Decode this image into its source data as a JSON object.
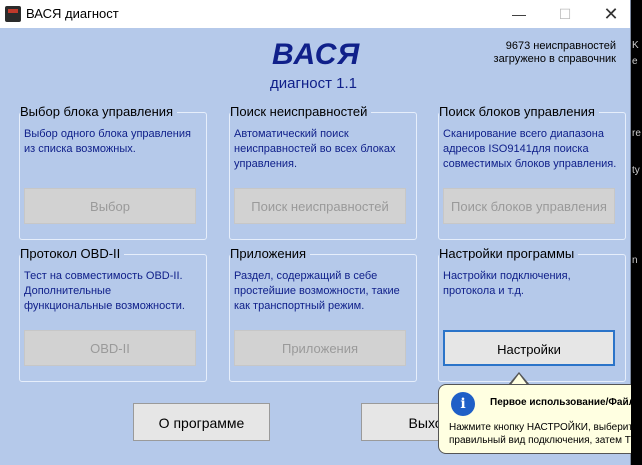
{
  "window": {
    "title": "ВАСЯ диагност",
    "minimize_glyph": "—",
    "maximize_glyph": "☐",
    "close_glyph": "✕"
  },
  "header": {
    "logo": "ВАСЯ",
    "subtitle": "диагност 1.1",
    "faults_line1": "9673 неисправностей",
    "faults_line2": "загружено в справочник"
  },
  "groups": [
    {
      "title": "Выбор блока управления",
      "desc": "Выбор одного блока управления из списка возможных.",
      "button": "Выбор"
    },
    {
      "title": "Поиск неисправностей",
      "desc": "Автоматический поиск неисправностей во всех блоках управления.",
      "button": "Поиск неисправностей"
    },
    {
      "title": "Поиск блоков управления",
      "desc": "Сканирование всего диапазона адресов ISO9141для поиска совместимых блоков управления.",
      "button": "Поиск блоков управления"
    },
    {
      "title": "Протокол OBD-II",
      "desc": "Тест на совместимость OBD-II. Дополнительные функциональные возможности.",
      "button": "OBD-II"
    },
    {
      "title": "Приложения",
      "desc": "Раздел, содержащий в себе простейшие возможности, такие как транспортный режим.",
      "button": "Приложения"
    },
    {
      "title": "Настройки программы",
      "desc": "Настройки подключения, протокола и т.д.",
      "button": "Настройки"
    }
  ],
  "bottom": {
    "about": "О программе",
    "exit": "Выход"
  },
  "tooltip": {
    "title": "Первое использование/Файл не найден",
    "line1": "Нажмите кнопку НАСТРОЙКИ, выберите",
    "line2": "правильный вид подключения, затем ТЕСТ"
  },
  "desktop_strip": [
    "K",
    "e",
    "re",
    "ty",
    "n"
  ]
}
